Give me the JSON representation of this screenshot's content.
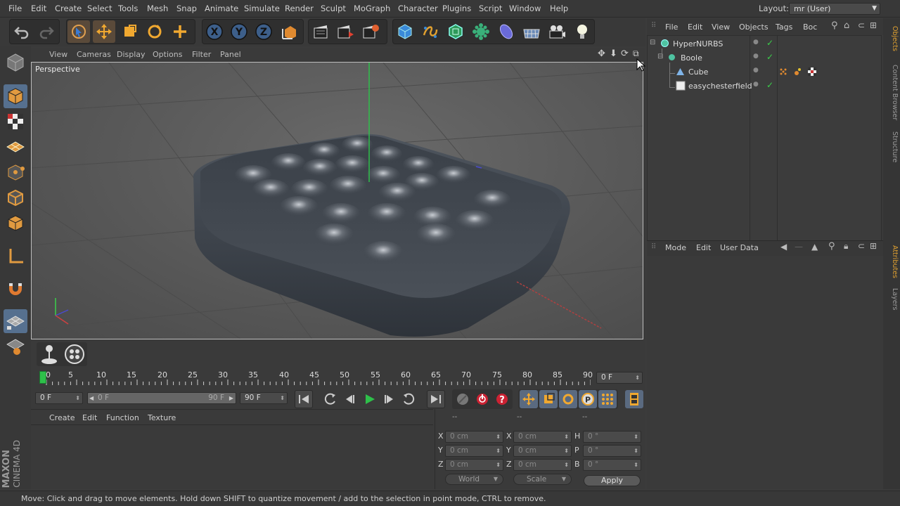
{
  "menu": [
    "File",
    "Edit",
    "Create",
    "Select",
    "Tools",
    "Mesh",
    "Snap",
    "Animate",
    "Simulate",
    "Render",
    "Sculpt",
    "MoGraph",
    "Character",
    "Plugins",
    "Script",
    "Window",
    "Help"
  ],
  "layout": {
    "label": "Layout:",
    "value": "mr (User)"
  },
  "viewport": {
    "menu": [
      "View",
      "Cameras",
      "Display",
      "Options",
      "Filter",
      "Panel"
    ],
    "label": "Perspective"
  },
  "timeline": {
    "ruler": [
      "0",
      "5",
      "10",
      "15",
      "20",
      "25",
      "30",
      "35",
      "40",
      "45",
      "50",
      "55",
      "60",
      "65",
      "70",
      "75",
      "80",
      "85",
      "90"
    ],
    "current_frame": "0 F",
    "start_frame": "0 F",
    "range_start": "0 F",
    "range_end": "90 F",
    "end_frame": "90 F"
  },
  "material_menu": [
    "Create",
    "Edit",
    "Function",
    "Texture"
  ],
  "coords": {
    "headers": [
      "--",
      "--",
      "--"
    ],
    "rows": [
      {
        "a": "X",
        "av": "0 cm",
        "b": "X",
        "bv": "0 cm",
        "c": "H",
        "cv": "0 °"
      },
      {
        "a": "Y",
        "av": "0 cm",
        "b": "Y",
        "bv": "0 cm",
        "c": "P",
        "cv": "0 °"
      },
      {
        "a": "Z",
        "av": "0 cm",
        "b": "Z",
        "bv": "0 cm",
        "c": "B",
        "cv": "0 °"
      }
    ],
    "mode1": "World",
    "mode2": "Scale",
    "apply": "Apply"
  },
  "objects": {
    "menu": [
      "File",
      "Edit",
      "View",
      "Objects",
      "Tags",
      "Boc"
    ],
    "items": [
      {
        "name": "HyperNURBS",
        "indent": 0,
        "icon": "hypernurbs-icon",
        "color": "#4fc3a1"
      },
      {
        "name": "Boole",
        "indent": 1,
        "icon": "boole-icon",
        "color": "#4fc3a1"
      },
      {
        "name": "Cube",
        "indent": 2,
        "icon": "cube-icon",
        "color": "#7fb4e8"
      },
      {
        "name": "easychesterfield",
        "indent": 2,
        "icon": "polygon-object-icon",
        "color": "#e8e8e8"
      }
    ]
  },
  "attributes": {
    "menu": [
      "Mode",
      "Edit",
      "User Data"
    ]
  },
  "side_tabs": [
    "Objects",
    "Content Browser",
    "Structure",
    "Attributes",
    "Layers"
  ],
  "logo": {
    "maker": "MAXON",
    "product": "CINEMA 4D"
  },
  "status": "Move: Click and drag to move elements. Hold down SHIFT to quantize movement / add to the selection in point mode, CTRL to remove."
}
